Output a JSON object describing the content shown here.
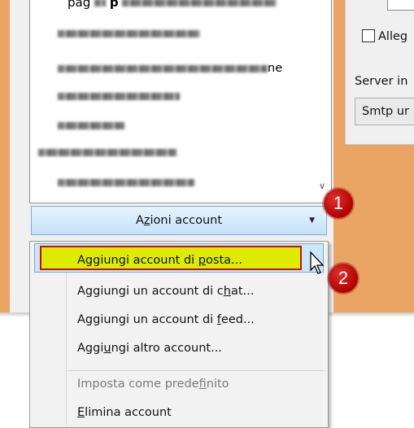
{
  "header": {
    "title_prefix": "pag",
    "title_bold": "p"
  },
  "account_list": {
    "visible_text_fragment": "ne"
  },
  "right_pane": {
    "checkbox_label": "Alleg",
    "server_label": "Server in",
    "smtp_value": "Smtp ur"
  },
  "actions_button": {
    "label_before": "A",
    "label_underlined": "z",
    "label_after": "ioni account",
    "caret_icon": "caret-down-icon"
  },
  "menu": {
    "items": [
      {
        "before": "Aggiungi account di ",
        "underlined": "p",
        "after": "osta...",
        "enabled": true
      },
      {
        "before": "Aggiungi un account di c",
        "underlined": "h",
        "after": "at...",
        "enabled": true
      },
      {
        "before": "Aggiungi un account di ",
        "underlined": "f",
        "after": "eed...",
        "enabled": true
      },
      {
        "before": "Aggi",
        "underlined": "u",
        "after": "ngi altro account...",
        "enabled": true
      },
      {
        "before": "Imposta come prede",
        "underlined": "f",
        "after": "inito",
        "enabled": false
      },
      {
        "before": "",
        "underlined": "E",
        "after": "limina account",
        "enabled": true
      }
    ]
  },
  "badges": {
    "step1": "1",
    "step2": "2"
  },
  "colors": {
    "frame": "#eaa463",
    "highlight": "#dcec00",
    "highlight_border": "#c01010",
    "badge": "#c00000",
    "button_border": "#79aedb"
  }
}
